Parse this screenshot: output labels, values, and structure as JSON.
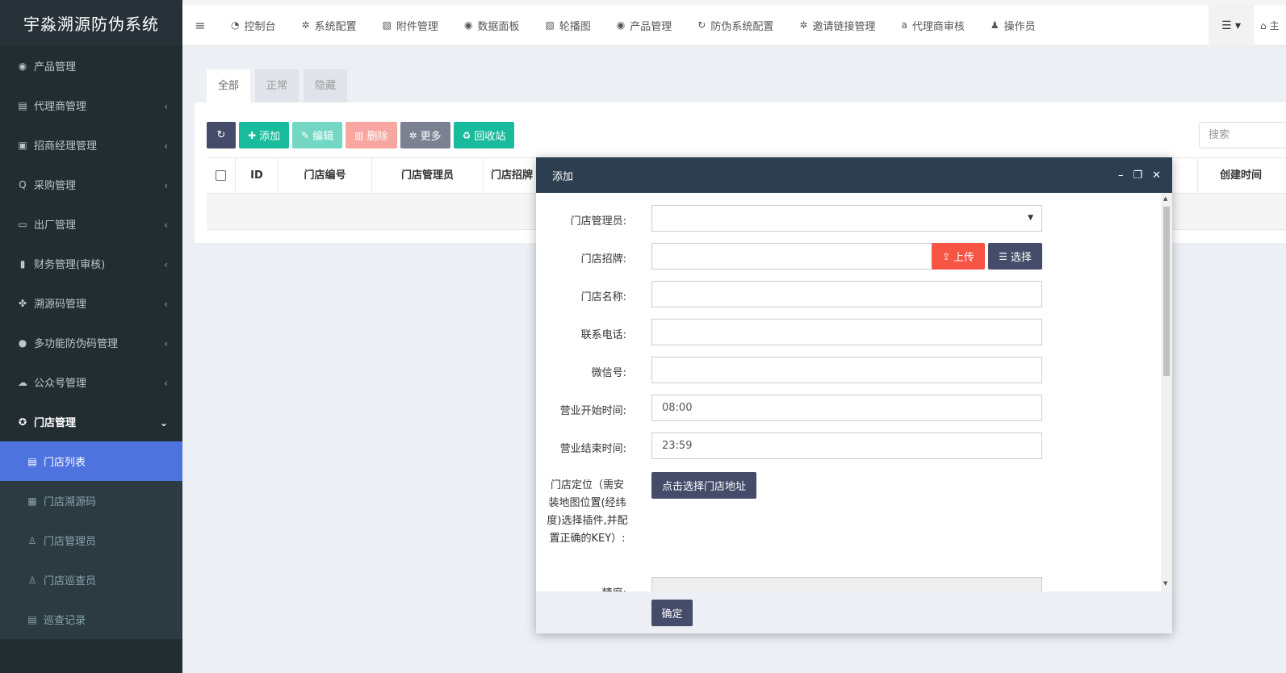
{
  "app_title": "宇淼溯源防伪系统",
  "sidebar": {
    "items": [
      {
        "label": "产品管理",
        "icon": "globe-icon",
        "glyph": "◉",
        "has_caret": false
      },
      {
        "label": "代理商管理",
        "icon": "id-card-icon",
        "glyph": "▤",
        "has_caret": true
      },
      {
        "label": "招商经理管理",
        "icon": "address-book-icon",
        "glyph": "▣",
        "has_caret": true
      },
      {
        "label": "采购管理",
        "icon": "search-icon",
        "glyph": "Q",
        "has_caret": true
      },
      {
        "label": "出厂管理",
        "icon": "truck-icon",
        "glyph": "▭",
        "has_caret": true
      },
      {
        "label": "财务管理(审核)",
        "icon": "stack-icon",
        "glyph": "▮",
        "has_caret": true
      },
      {
        "label": "溯源码管理",
        "icon": "cubes-icon",
        "glyph": "✤",
        "has_caret": true
      },
      {
        "label": "多功能防伪码管理",
        "icon": "info-circle-icon",
        "glyph": "●",
        "has_caret": true
      },
      {
        "label": "公众号管理",
        "icon": "wechat-icon",
        "glyph": "☁",
        "has_caret": true
      }
    ],
    "open_item": {
      "label": "门店管理",
      "icon": "life-ring-icon",
      "glyph": "✪"
    },
    "sub_items": [
      {
        "label": "门店列表",
        "icon": "list-alt-icon",
        "glyph": "▤",
        "active": true
      },
      {
        "label": "门店溯源码",
        "icon": "qrcode-icon",
        "glyph": "▦",
        "active": false
      },
      {
        "label": "门店管理员",
        "icon": "user-icon",
        "glyph": "♙",
        "active": false
      },
      {
        "label": "门店巡查员",
        "icon": "user-icon",
        "glyph": "♙",
        "active": false
      },
      {
        "label": "巡查记录",
        "icon": "list-icon",
        "glyph": "▤",
        "active": false
      }
    ]
  },
  "topnav": {
    "items": [
      {
        "label": "控制台",
        "icon": "dashboard-icon",
        "glyph": "◔"
      },
      {
        "label": "系统配置",
        "icon": "gear-icon",
        "glyph": "✲"
      },
      {
        "label": "附件管理",
        "icon": "image-icon",
        "glyph": "▧"
      },
      {
        "label": "数据面板",
        "icon": "globe-icon",
        "glyph": "◉"
      },
      {
        "label": "轮播图",
        "icon": "image-icon",
        "glyph": "▧"
      },
      {
        "label": "产品管理",
        "icon": "globe-icon",
        "glyph": "◉"
      },
      {
        "label": "防伪系统配置",
        "icon": "refresh-icon",
        "glyph": "↻"
      },
      {
        "label": "邀请链接管理",
        "icon": "gears-icon",
        "glyph": "✲"
      },
      {
        "label": "代理商审核",
        "icon": "amazon-icon",
        "glyph": "a"
      },
      {
        "label": "操作员",
        "icon": "user-icon",
        "glyph": "♟"
      }
    ],
    "home_label": "主"
  },
  "tabs": [
    {
      "label": "全部",
      "active": true
    },
    {
      "label": "正常",
      "active": false
    },
    {
      "label": "隐藏",
      "active": false
    }
  ],
  "toolbar": {
    "add": "添加",
    "edit": "编辑",
    "delete": "删除",
    "more": "更多",
    "recycle": "回收站"
  },
  "search": {
    "placeholder": "搜索"
  },
  "table": {
    "headers": [
      "ID",
      "门店编号",
      "门店管理员",
      "门店招牌",
      "创建时间"
    ]
  },
  "modal": {
    "title": "添加",
    "fields": {
      "admin_label": "门店管理员:",
      "admin_value": "",
      "sign_label": "门店招牌:",
      "sign_value": "",
      "upload_btn": "上传",
      "choose_btn": "选择",
      "name_label": "门店名称:",
      "name_value": "",
      "phone_label": "联系电话:",
      "phone_value": "",
      "wechat_label": "微信号:",
      "wechat_value": "",
      "open_label": "营业开始时间:",
      "open_value": "08:00",
      "close_label": "营业结束时间:",
      "close_value": "23:59",
      "location_label": "门店定位（需安装地图位置(经纬度)选择插件,并配置正确的KEY）:",
      "location_btn": "点击选择门店地址",
      "lng_label": "精度:"
    },
    "ok": "确定"
  },
  "colors": {
    "sidebar_bg": "#222d32",
    "active_blue": "#4e73df",
    "modal_header": "#2c3e50",
    "primary_dark": "#444c69",
    "success": "#18bc9c",
    "danger": "#f75444"
  }
}
